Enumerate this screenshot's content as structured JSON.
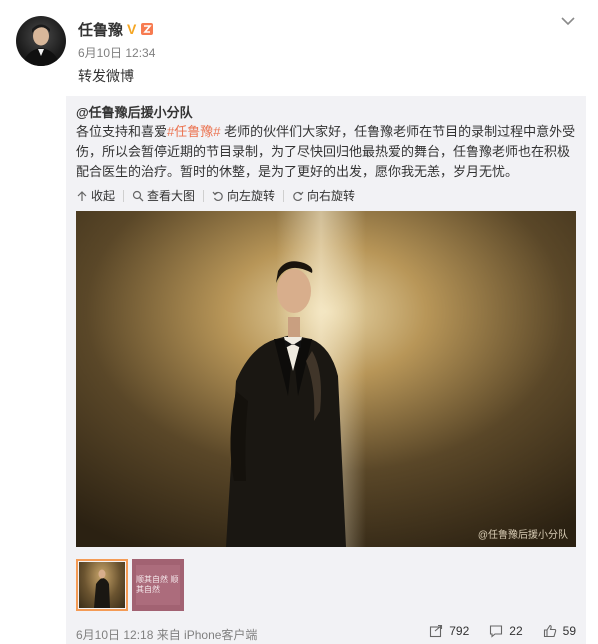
{
  "post": {
    "author": "任鲁豫",
    "time": "6月10日 12:34",
    "text": "转发微博"
  },
  "quoted": {
    "author": "@任鲁豫后援小分队",
    "text_parts": {
      "before": "各位支持和喜爱",
      "hashtag": "#任鲁豫#",
      "after": " 老师的伙伴们大家好，任鲁豫老师在节目的录制过程中意外受伤，所以会暂停近期的节目录制，为了尽快回归他最热爱的舞台，任鲁豫老师也在积极配合医生的治疗。暂时的休整，是为了更好的出发，愿你我无恙，岁月无忧。"
    },
    "actions": {
      "collapse": "收起",
      "view_large": "查看大图",
      "rotate_left": "向左旋转",
      "rotate_right": "向右旋转"
    },
    "watermark": "@任鲁豫后援小分队",
    "thumb2_text": "顺其自然 顺其自然",
    "footer": {
      "meta": "6月10日 12:18 来自 iPhone客户端",
      "reposts": "792",
      "comments": "22",
      "likes": "59"
    }
  },
  "colors": {
    "hashtag": "#eb7350",
    "badge": "#f5a623",
    "quoted_bg": "#f2f2f5",
    "thumb_border": "#f49b55"
  }
}
